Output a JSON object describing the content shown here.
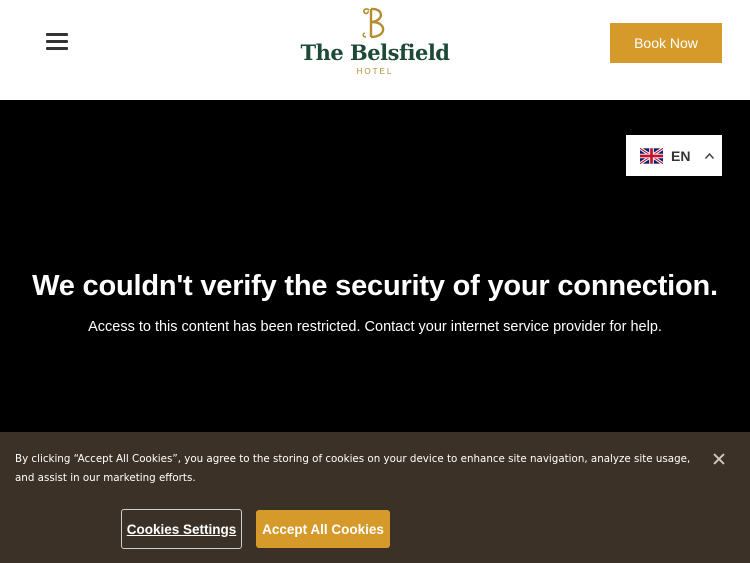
{
  "header": {
    "brand_name": "The Belsfield",
    "brand_sub": "HOTEL",
    "book_label": "Book Now"
  },
  "language": {
    "code": "EN",
    "flag_icon": "uk-flag-icon"
  },
  "message": {
    "headline": "We couldn't verify the security of your connection.",
    "subline": "Access to this content has been restricted. Contact your internet service provider for help."
  },
  "cookie_banner": {
    "text": "By clicking “Accept All Cookies”, you agree to the storing of cookies on your device to enhance site navigation, analyze site usage, and assist in our marketing efforts.",
    "settings_label": "Cookies Settings",
    "accept_label": "Accept All Cookies"
  },
  "colors": {
    "accent": "#d59a2a",
    "brand_green": "#1d4a36",
    "banner_bg": "#3b3126"
  }
}
